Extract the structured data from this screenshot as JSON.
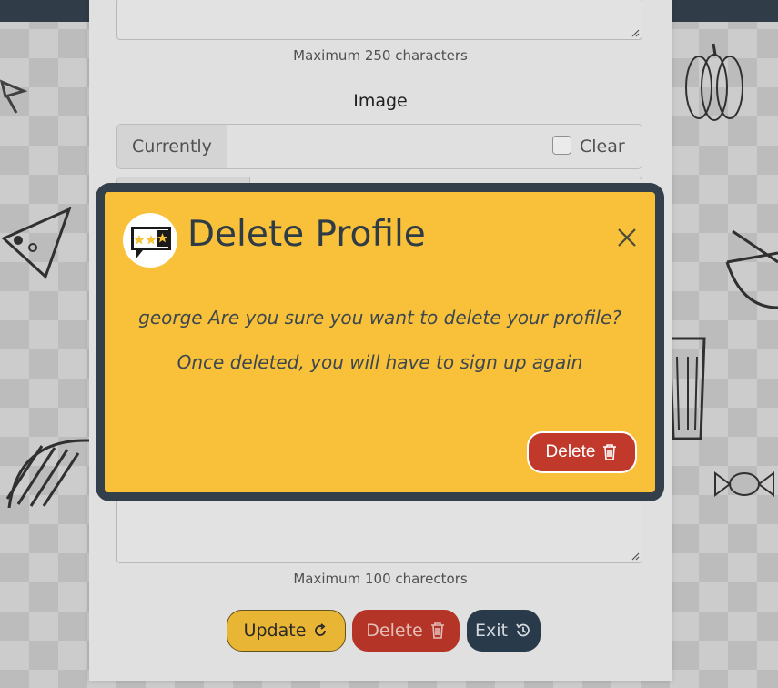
{
  "form": {
    "about_hint": "Maximum 250 characters",
    "image_label": "Image",
    "currently_label": "Currently",
    "clear_label": "Clear",
    "bio_hint": "Maximum 100 charectors"
  },
  "buttons": {
    "update_label": "Update",
    "delete_label": "Delete",
    "exit_label": "Exit"
  },
  "modal": {
    "title": "Delete Profile",
    "message_1": "george Are you sure you want to delete your profile?",
    "message_2": "Once deleted, you will have to sign up again",
    "delete_label": "Delete"
  },
  "colors": {
    "topbar": "#33404c",
    "modal_bg": "#f8c139",
    "modal_frame": "#33404c",
    "danger": "#c0392b",
    "dark": "#2c3e50"
  },
  "icons": {
    "update": "refresh-icon",
    "delete": "trash-icon",
    "exit": "history-icon",
    "close": "close-icon",
    "logo": "review-stars-logo"
  }
}
